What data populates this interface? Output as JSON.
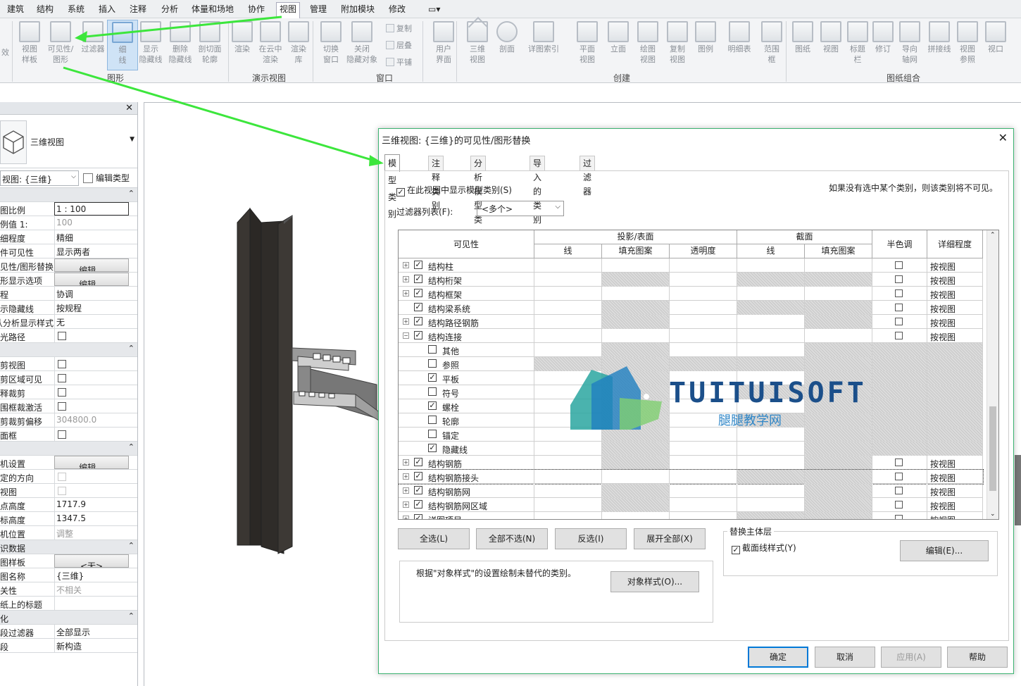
{
  "menu": [
    "建筑",
    "结构",
    "系统",
    "插入",
    "注释",
    "分析",
    "体量和场地",
    "协作",
    "视图",
    "管理",
    "附加模块",
    "修改"
  ],
  "menu_active": "视图",
  "ribbon": {
    "buttons": [
      {
        "l1": "视图",
        "l2": "样板"
      },
      {
        "l1": "可见性/",
        "l2": "图形"
      },
      {
        "l1": "过滤器",
        "l2": ""
      },
      {
        "l1": "细",
        "l2": "线"
      },
      {
        "l1": "显示",
        "l2": "隐藏线"
      },
      {
        "l1": "删除",
        "l2": "隐藏线"
      },
      {
        "l1": "剖切面",
        "l2": "轮廓"
      },
      {
        "l1": "渲染",
        "l2": ""
      },
      {
        "l1": "在云中",
        "l2": "渲染"
      },
      {
        "l1": "渲染",
        "l2": "库"
      },
      {
        "l1": "切换",
        "l2": "窗口"
      },
      {
        "l1": "关闭",
        "l2": "隐藏对象"
      },
      {
        "l1": "用户",
        "l2": "界面"
      },
      {
        "l1": "三维",
        "l2": "视图"
      },
      {
        "l1": "剖面",
        "l2": ""
      },
      {
        "l1": "详图索引",
        "l2": ""
      },
      {
        "l1": "平面",
        "l2": "视图"
      },
      {
        "l1": "立面",
        "l2": ""
      },
      {
        "l1": "绘图",
        "l2": "视图"
      },
      {
        "l1": "复制",
        "l2": "视图"
      },
      {
        "l1": "图例",
        "l2": ""
      },
      {
        "l1": "明细表",
        "l2": ""
      },
      {
        "l1": "范围",
        "l2": "框"
      },
      {
        "l1": "图纸",
        "l2": ""
      },
      {
        "l1": "视图",
        "l2": ""
      },
      {
        "l1": "标题",
        "l2": "栏"
      },
      {
        "l1": "修订",
        "l2": ""
      },
      {
        "l1": "导向",
        "l2": "轴网"
      },
      {
        "l1": "拼接线",
        "l2": ""
      },
      {
        "l1": "视图",
        "l2": "参照"
      },
      {
        "l1": "视口",
        "l2": ""
      }
    ],
    "small": [
      "复制",
      "层叠",
      "平铺"
    ],
    "groups": [
      "图形",
      "演示视图",
      "窗口",
      "创建",
      "图纸组合"
    ],
    "cut_left": "效"
  },
  "properties": {
    "type_name": "三维视图",
    "selector": "视图: {三维}",
    "edit_type": "编辑类型",
    "rows": [
      {
        "k": "",
        "v": "",
        "kind": "sec"
      },
      {
        "k": "图比例",
        "v": "1 : 100",
        "kind": "box"
      },
      {
        "k": "例值 1:",
        "v": "100",
        "kind": "gray"
      },
      {
        "k": "细程度",
        "v": "精细",
        "kind": "text"
      },
      {
        "k": "件可见性",
        "v": "显示两者",
        "kind": "text"
      },
      {
        "k": "见性/图形替换",
        "v": "编辑...",
        "kind": "btn"
      },
      {
        "k": "形显示选项",
        "v": "编辑...",
        "kind": "btn"
      },
      {
        "k": "程",
        "v": "协调",
        "kind": "text"
      },
      {
        "k": "示隐藏线",
        "v": "按规程",
        "kind": "text"
      },
      {
        "k": "认分析显示样式",
        "v": "无",
        "kind": "text"
      },
      {
        "k": "光路径",
        "v": "",
        "kind": "cb"
      },
      {
        "k": "",
        "v": "",
        "kind": "sec"
      },
      {
        "k": "剪视图",
        "v": "",
        "kind": "cb"
      },
      {
        "k": "剪区域可见",
        "v": "",
        "kind": "cb"
      },
      {
        "k": "释裁剪",
        "v": "",
        "kind": "cb"
      },
      {
        "k": "围框裁激活",
        "v": "",
        "kind": "cb"
      },
      {
        "k": "剪裁剪偏移",
        "v": "304800.0",
        "kind": "gray"
      },
      {
        "k": "面框",
        "v": "",
        "kind": "cb"
      },
      {
        "k": "",
        "v": "",
        "kind": "sec"
      },
      {
        "k": "机设置",
        "v": "编辑...",
        "kind": "btn"
      },
      {
        "k": "定的方向",
        "v": "",
        "kind": "cbdis"
      },
      {
        "k": "视图",
        "v": "",
        "kind": "cbdis"
      },
      {
        "k": "点高度",
        "v": "1717.9",
        "kind": "text"
      },
      {
        "k": "标高度",
        "v": "1347.5",
        "kind": "text"
      },
      {
        "k": "机位置",
        "v": "调整",
        "kind": "gray"
      },
      {
        "k": "识数据",
        "v": "",
        "kind": "sec"
      },
      {
        "k": "图样板",
        "v": "<无>",
        "kind": "btn"
      },
      {
        "k": "图名称",
        "v": "{三维}",
        "kind": "text"
      },
      {
        "k": "关性",
        "v": "不相关",
        "kind": "gray"
      },
      {
        "k": "纸上的标题",
        "v": "",
        "kind": "text"
      },
      {
        "k": "化",
        "v": "",
        "kind": "sec"
      },
      {
        "k": "段过滤器",
        "v": "全部显示",
        "kind": "text"
      },
      {
        "k": "段",
        "v": "新构造",
        "kind": "text"
      }
    ]
  },
  "dialog": {
    "title": "三维视图: {三维}的可见性/图形替换",
    "tabs": [
      "模型类别",
      "注释类别",
      "分析模型类别",
      "导入的类别",
      "过滤器"
    ],
    "show_model_label": "在此视图中显示模型类别(S)",
    "hint": "如果没有选中某个类别，则该类别将不可见。",
    "filter_label": "过滤器列表(F):",
    "filter_value": "<多个>",
    "headers": {
      "visibility": "可见性",
      "projection": "投影/表面",
      "cut": "截面",
      "halftone": "半色调",
      "detail": "详细程度",
      "line": "线",
      "pattern": "填充图案",
      "transparency": "透明度",
      "cut_line": "线",
      "cut_pattern": "填充图案"
    },
    "rows": [
      {
        "name": "结构柱",
        "level": 0,
        "checked": true,
        "exp": "+",
        "proj_pat": false,
        "cut_line": false,
        "cut_pat": false,
        "half": true,
        "detail": "按视图"
      },
      {
        "name": "结构桁架",
        "level": 0,
        "checked": true,
        "exp": "+",
        "proj_pat": true,
        "cut_line": true,
        "cut_pat": true,
        "half": true,
        "detail": "按视图"
      },
      {
        "name": "结构框架",
        "level": 0,
        "checked": true,
        "exp": "+",
        "proj_pat": false,
        "cut_line": false,
        "cut_pat": false,
        "half": true,
        "detail": "按视图"
      },
      {
        "name": "结构梁系统",
        "level": 0,
        "checked": true,
        "exp": "",
        "proj_pat": true,
        "cut_line": true,
        "cut_pat": true,
        "half": true,
        "detail": "按视图"
      },
      {
        "name": "结构路径钢筋",
        "level": 0,
        "checked": true,
        "exp": "+",
        "proj_pat": true,
        "cut_line": false,
        "cut_pat": true,
        "half": true,
        "detail": "按视图"
      },
      {
        "name": "结构连接",
        "level": 0,
        "checked": true,
        "exp": "−",
        "proj_pat": false,
        "cut_line": false,
        "cut_pat": false,
        "half": true,
        "detail": "按视图"
      },
      {
        "name": "其他",
        "level": 1,
        "checked": false,
        "proj_pat": true,
        "cut_line": false,
        "cut_pat": true,
        "sub": true
      },
      {
        "name": "参照",
        "level": 1,
        "checked": false,
        "proj_pat": true,
        "cut_line": true,
        "cut_pat": true,
        "sub": true
      },
      {
        "name": "平板",
        "level": 1,
        "checked": true,
        "proj_pat": true,
        "cut_line": false,
        "cut_pat": true,
        "sub": true
      },
      {
        "name": "符号",
        "level": 1,
        "checked": false,
        "proj_pat": true,
        "cut_line": true,
        "cut_pat": true,
        "sub": true
      },
      {
        "name": "螺栓",
        "level": 1,
        "checked": true,
        "proj_pat": true,
        "cut_line": false,
        "cut_pat": true,
        "sub": true
      },
      {
        "name": "轮廓",
        "level": 1,
        "checked": false,
        "proj_pat": true,
        "cut_line": true,
        "cut_pat": true,
        "sub": true
      },
      {
        "name": "锚定",
        "level": 1,
        "checked": false,
        "proj_pat": true,
        "cut_line": false,
        "cut_pat": true,
        "sub": true
      },
      {
        "name": "隐藏线",
        "level": 1,
        "checked": true,
        "proj_pat": true,
        "cut_line": false,
        "cut_pat": true,
        "sub": true
      },
      {
        "name": "结构钢筋",
        "level": 0,
        "checked": true,
        "exp": "+",
        "proj_pat": true,
        "cut_line": false,
        "cut_pat": true,
        "half": true,
        "detail": "按视图"
      },
      {
        "name": "结构钢筋接头",
        "level": 0,
        "checked": true,
        "exp": "+",
        "proj_pat": false,
        "cut_line": true,
        "cut_pat": true,
        "half": true,
        "detail": "按视图",
        "focus": true
      },
      {
        "name": "结构钢筋网",
        "level": 0,
        "checked": true,
        "exp": "+",
        "proj_pat": true,
        "cut_line": false,
        "cut_pat": true,
        "half": true,
        "detail": "按视图"
      },
      {
        "name": "结构钢筋网区域",
        "level": 0,
        "checked": true,
        "exp": "+",
        "proj_pat": true,
        "cut_line": false,
        "cut_pat": true,
        "half": true,
        "detail": "按视图"
      },
      {
        "name": "详图项目",
        "level": 0,
        "checked": true,
        "exp": "+",
        "proj_pat": false,
        "cut_line": true,
        "cut_pat": true,
        "half": true,
        "detail": "按视图"
      }
    ],
    "buttons": {
      "select_all": "全选(L)",
      "select_none": "全部不选(N)",
      "invert": "反选(I)",
      "expand_all": "展开全部(X)",
      "object_styles": "对象样式(O)...",
      "edit": "编辑(E)...",
      "ok": "确定",
      "cancel": "取消",
      "apply": "应用(A)",
      "help": "帮助"
    },
    "host_group": "替换主体层",
    "cut_line_styles": "截面线样式(Y)",
    "object_style_note": "根据\"对象样式\"的设置绘制未替代的类别。"
  },
  "watermark": {
    "title": "TUITUISOFT",
    "subtitle": "腿腿教学网"
  },
  "colors": {
    "arrow": "#3ce63c",
    "accent": "#0078d7",
    "dialog_border": "#3cb371"
  }
}
